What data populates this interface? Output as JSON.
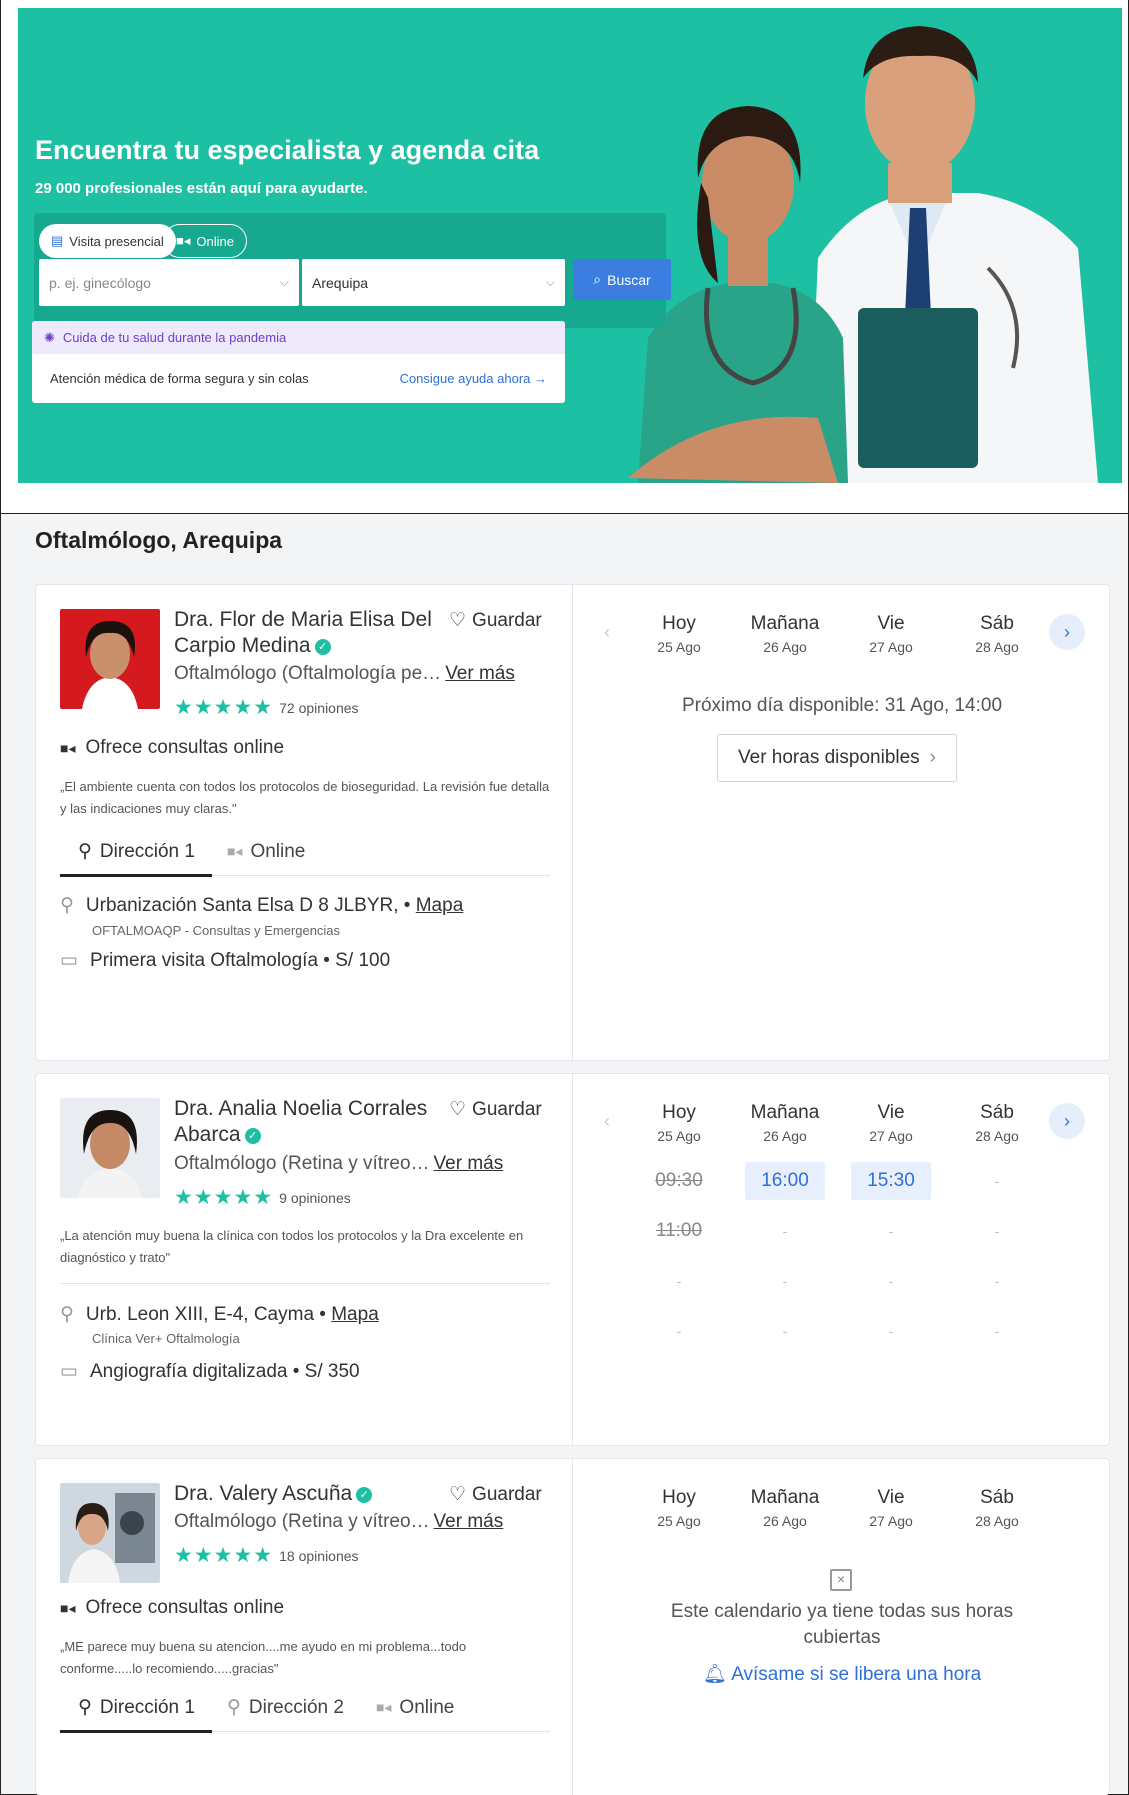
{
  "hero": {
    "title": "Encuentra tu especialista y agenda cita",
    "subtitle": "29 000 profesionales están aquí para ayudarte.",
    "tab_visit": "Visita presencial",
    "tab_online": "Online",
    "specialty_placeholder": "p. ej. ginecólogo",
    "city_value": "Arequipa",
    "search_button": "Buscar",
    "notice_title": "Cuida de tu salud durante la pandemia",
    "notice_text": "Atención médica de forma segura y sin colas",
    "notice_link": "Consigue ayuda ahora →"
  },
  "results": {
    "title": "Oftalmólogo, Arequipa",
    "days": [
      {
        "day": "Hoy",
        "date": "25 Ago"
      },
      {
        "day": "Mañana",
        "date": "26 Ago"
      },
      {
        "day": "Vie",
        "date": "27 Ago"
      },
      {
        "day": "Sáb",
        "date": "28 Ago"
      }
    ],
    "save_label": "Guardar",
    "more_label": "Ver más",
    "online_offer": "Ofrece consultas online",
    "map_label": "Mapa",
    "doctors": [
      {
        "name": "Dra. Flor de Maria Elisa Del Carpio Medina",
        "specialty": "Oftalmólogo (Oftalmología pe…",
        "stars": "★★★★★",
        "reviews": "72 opiniones",
        "quote": "„El ambiente cuenta con todos los protocolos de bioseguridad. La revisión fue detalla y las indicaciones muy claras.\"",
        "tab1": "Dirección 1",
        "tab_online": "Online",
        "address": "Urbanización Santa Elsa D 8 JLBYR, •",
        "clinic": "OFTALMOAQP - Consultas y Emergencias",
        "visit": "Primera visita Oftalmología • S/ 100",
        "next_available": "Próximo día disponible: 31 Ago, 14:00",
        "view_hours": "Ver horas disponibles"
      },
      {
        "name": "Dra. Analia Noelia Corrales Abarca",
        "specialty": "Oftalmólogo (Retina y vítreo…",
        "stars": "★★★★★",
        "reviews": "9 opiniones",
        "quote": "„La atención muy buena la clínica con todos los protocolos y la Dra excelente en diagnóstico y trato\"",
        "address": "Urb. Leon XIII, E-4, Cayma •",
        "clinic": "Clínica Ver+ Oftalmología",
        "visit": "Angiografía digitalizada • S/ 350",
        "slots": [
          [
            "09:30",
            "16:00",
            "15:30",
            "-"
          ],
          [
            "11:00",
            "-",
            "-",
            "-"
          ],
          [
            "-",
            "-",
            "-",
            "-"
          ],
          [
            "-",
            "-",
            "-",
            "-"
          ]
        ]
      },
      {
        "name": "Dra. Valery Ascuña",
        "specialty": "Oftalmólogo (Retina y vítreo…",
        "stars": "★★★★★",
        "reviews": "18 opiniones",
        "quote": "„ME parece muy buena su atencion....me ayudo en mi problema...todo conforme.....lo recomiendo.....gracias\"",
        "tab1": "Dirección 1",
        "tab2": "Dirección 2",
        "tab_online": "Online",
        "full_message": "Este calendario ya tiene todas sus horas cubiertas",
        "notify": "Avísame si se libera una hora"
      }
    ]
  }
}
